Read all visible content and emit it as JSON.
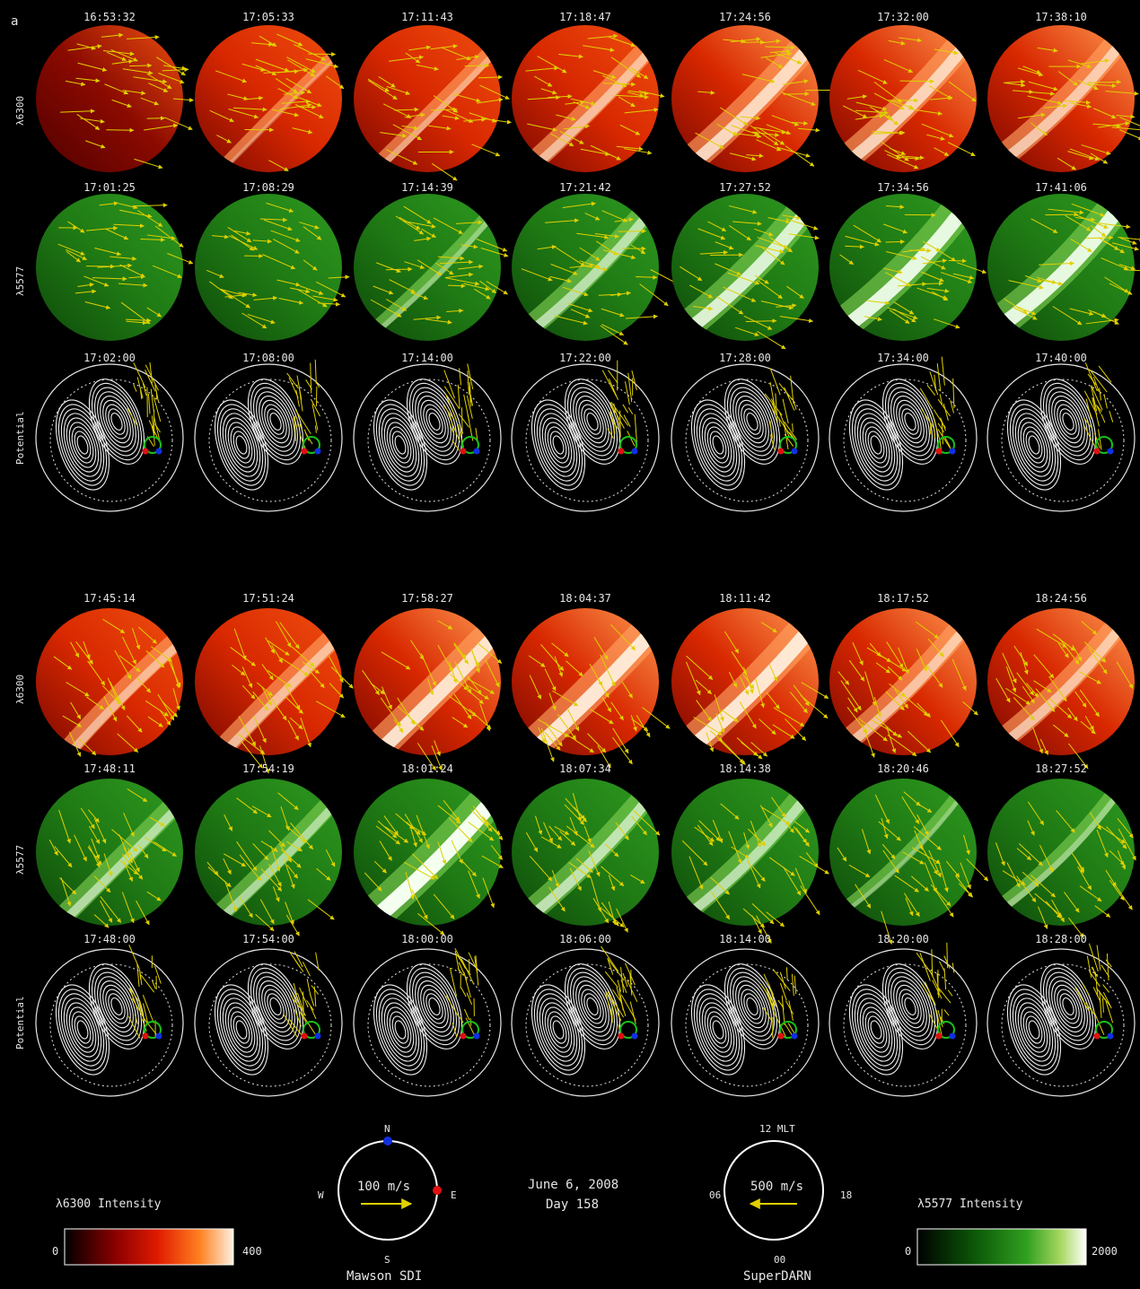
{
  "figure": {
    "panel_label": "a",
    "date": "June 6, 2008",
    "day": "Day 158",
    "row_labels": {
      "red": "λ6300",
      "green": "λ5577",
      "potential": "Potential"
    },
    "blocks": [
      {
        "red_times": [
          "16:53:32",
          "17:05:33",
          "17:11:43",
          "17:18:47",
          "17:24:56",
          "17:32:00",
          "17:38:10"
        ],
        "green_times": [
          "17:01:25",
          "17:08:29",
          "17:14:39",
          "17:21:42",
          "17:27:52",
          "17:34:56",
          "17:41:06"
        ],
        "potential_times": [
          "17:02:00",
          "17:08:00",
          "17:14:00",
          "17:22:00",
          "17:28:00",
          "17:34:00",
          "17:40:00"
        ]
      },
      {
        "red_times": [
          "17:45:14",
          "17:51:24",
          "17:58:27",
          "18:04:37",
          "18:11:42",
          "18:17:52",
          "18:24:56"
        ],
        "green_times": [
          "17:48:11",
          "17:54:19",
          "18:01:24",
          "18:07:34",
          "18:14:38",
          "18:20:46",
          "18:27:52"
        ],
        "potential_times": [
          "17:48:00",
          "17:54:00",
          "18:00:00",
          "18:06:00",
          "18:14:00",
          "18:20:00",
          "18:28:00"
        ]
      }
    ],
    "legend_sdi": {
      "north": "N",
      "south": "S",
      "west": "W",
      "east": "E",
      "speed": "100 m/s",
      "caption": "Mawson SDI"
    },
    "legend_superdarn": {
      "top": "12 MLT",
      "bottom": "00",
      "left": "06",
      "right": "18",
      "speed": "500 m/s",
      "caption": "SuperDARN"
    },
    "colorbar_red": {
      "title": "λ6300 Intensity",
      "min": "0",
      "max": "400"
    },
    "colorbar_green": {
      "title": "λ5577 Intensity",
      "min": "0",
      "max": "2000"
    },
    "colors": {
      "arrow": "#e0d000",
      "marker_red": "#e01010",
      "marker_blue": "#1030e0",
      "marker_green": "#18c018"
    }
  }
}
